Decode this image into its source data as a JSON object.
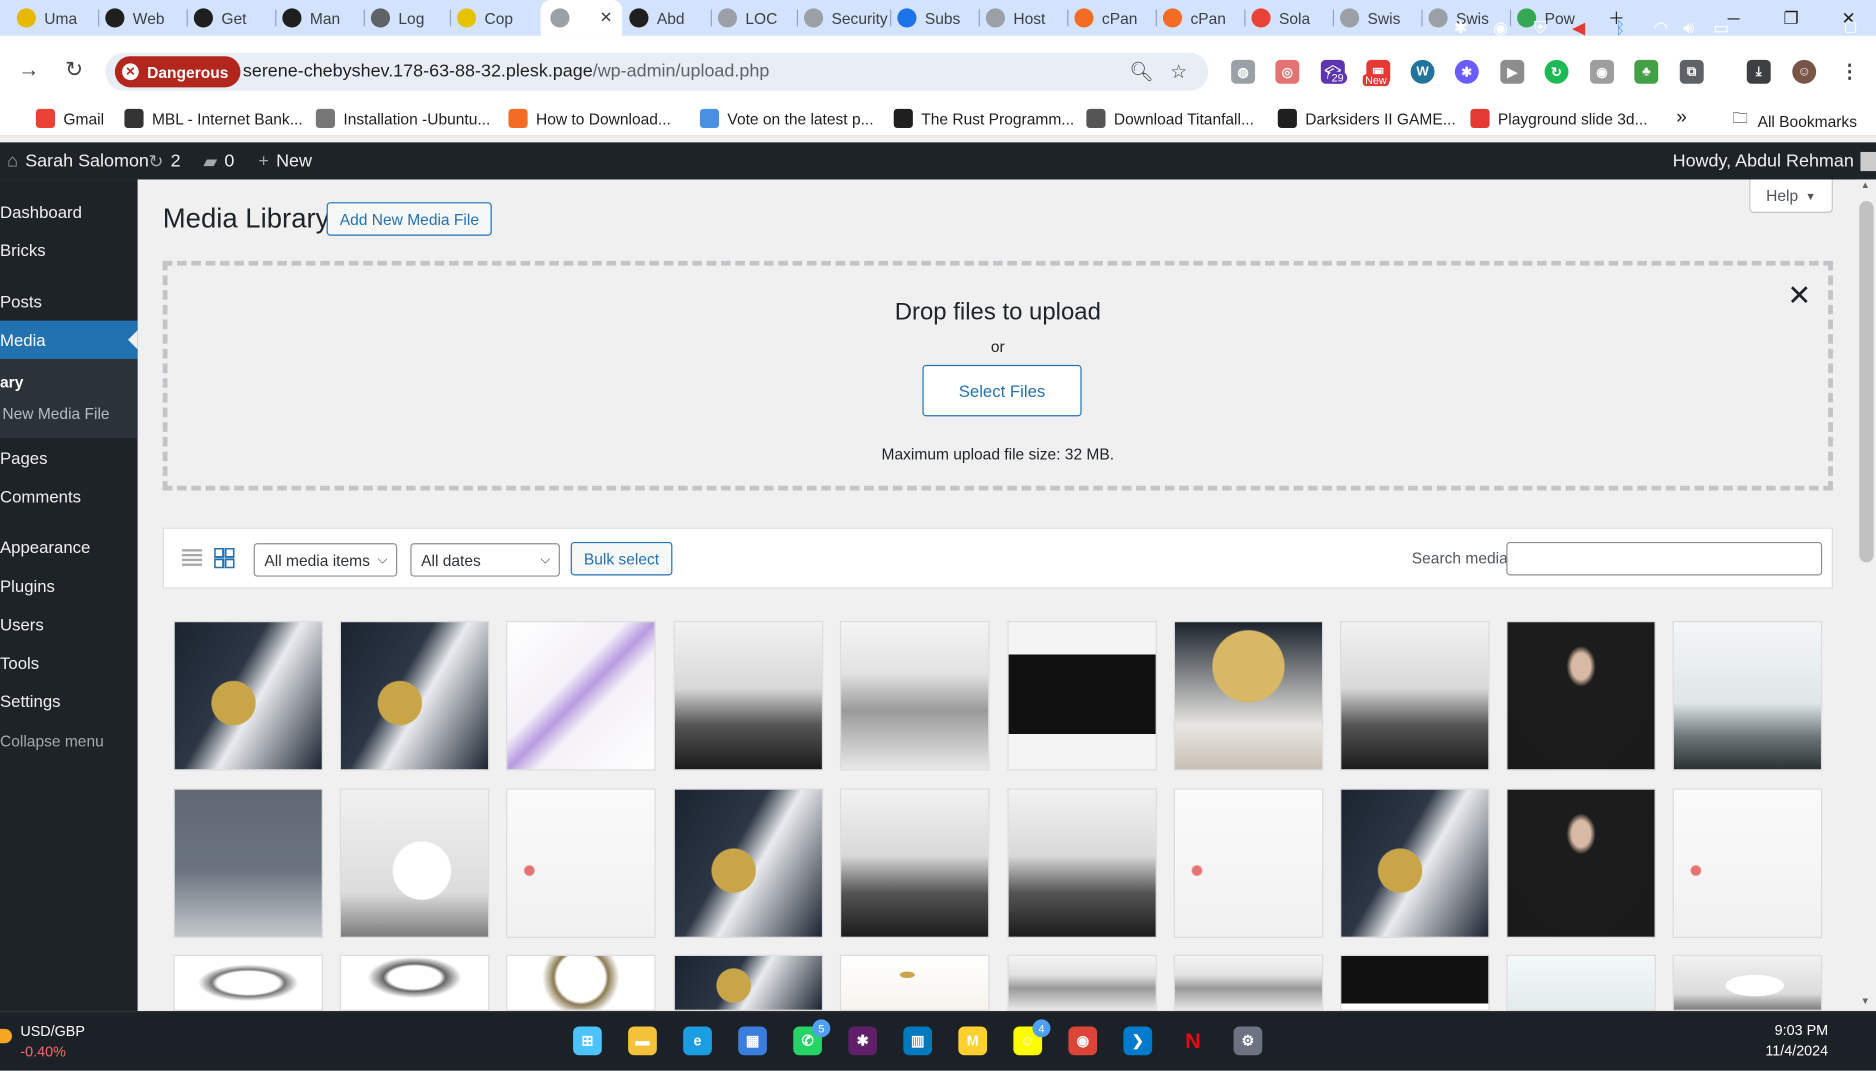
{
  "browser": {
    "tabs": [
      {
        "label": "Uma",
        "color": "#e6b800"
      },
      {
        "label": "Web",
        "color": "#1f1f1f"
      },
      {
        "label": "Get",
        "color": "#1f1f1f"
      },
      {
        "label": "Man",
        "color": "#1f1f1f"
      },
      {
        "label": "Log",
        "color": "#5f6368"
      },
      {
        "label": "Cop",
        "color": "#e6c300"
      },
      {
        "label": "",
        "color": "#9aa0a6"
      },
      {
        "label": "Abd",
        "color": "#1f1f1f"
      },
      {
        "label": "LOC",
        "color": "#9aa0a6"
      },
      {
        "label": "Security",
        "color": "#9aa0a6"
      },
      {
        "label": "Subs",
        "color": "#1a73e8"
      },
      {
        "label": "Host",
        "color": "#9aa0a6"
      },
      {
        "label": "cPan",
        "color": "#f36c23"
      },
      {
        "label": "cPan",
        "color": "#f36c23"
      },
      {
        "label": "Sola",
        "color": "#ea4335"
      },
      {
        "label": "Swis",
        "color": "#9aa0a6"
      },
      {
        "label": "Swis",
        "color": "#9aa0a6"
      },
      {
        "label": "Pow",
        "color": "#34a853"
      }
    ],
    "security_label": "Dangerous",
    "url_host": "serene-chebyshev.178-63-88-32.plesk.page",
    "url_path": "/wp-admin/upload.php",
    "extension_badges": {
      "notifications": "29",
      "new": "New"
    },
    "bookmarks": [
      {
        "label": "Gmail",
        "color": "#ea4335"
      },
      {
        "label": "MBL - Internet Bank...",
        "color": "#333333"
      },
      {
        "label": "Installation -Ubuntu...",
        "color": "#777777"
      },
      {
        "label": "How to Download...",
        "color": "#f36c23"
      },
      {
        "label": "Vote on the latest p...",
        "color": "#4a90e2"
      },
      {
        "label": "The Rust Programm...",
        "color": "#1f1f1f"
      },
      {
        "label": "Download Titanfall...",
        "color": "#555555"
      },
      {
        "label": "Darksiders II GAME...",
        "color": "#1f1f1f"
      },
      {
        "label": "Playground slide 3d...",
        "color": "#e53935"
      }
    ],
    "all_bookmarks": "All Bookmarks"
  },
  "adminbar": {
    "site_name": "Sarah Salomon",
    "updates": "2",
    "comments": "0",
    "new_label": "New",
    "howdy": "Howdy, Abdul Rehman"
  },
  "sidebar": {
    "items": [
      {
        "label": "Dashboard"
      },
      {
        "label": "Bricks"
      },
      {
        "label": "Posts"
      },
      {
        "label": "Media"
      },
      {
        "label": "Pages"
      },
      {
        "label": "Comments"
      },
      {
        "label": "Appearance"
      },
      {
        "label": "Plugins"
      },
      {
        "label": "Users"
      },
      {
        "label": "Tools"
      },
      {
        "label": "Settings"
      },
      {
        "label": "Collapse menu"
      }
    ],
    "submenu": [
      "ary",
      "New Media File"
    ]
  },
  "main": {
    "title": "Media Library",
    "add_new": "Add New Media File",
    "help": "Help",
    "upload": {
      "drop_title": "Drop files to upload",
      "or": "or",
      "select_files": "Select Files",
      "max_size": "Maximum upload file size: 32 MB."
    },
    "filters": {
      "type": "All media items",
      "dates": "All dates",
      "bulk_select": "Bulk select",
      "search_label": "Search media",
      "search_value": ""
    },
    "media_grid": [
      [
        "moon",
        "moon",
        "product-box",
        "wolf-fog",
        "mountain-fog",
        "black-band",
        "moon-woman",
        "wolf-fog",
        "woman-dark",
        "misty-sea"
      ],
      [
        "gray-gradient",
        "swan",
        "white-brush",
        "moon",
        "wolf-fog",
        "wolf-fog",
        "white-brush",
        "moon",
        "woman-dark",
        "white-brush"
      ],
      [
        "jewel-heart",
        "jewel-diamond",
        "jewel-ring",
        "moon",
        "gold-script",
        "mountain-fog",
        "mountain-fog",
        "black-square",
        "pale-mist",
        "swan"
      ]
    ]
  },
  "taskbar": {
    "ticker_name": "USD/GBP",
    "ticker_change": "-0.40%",
    "time": "9:03 PM",
    "date": "11/4/2024",
    "whatsapp_badge": "5",
    "snap_badge": "4"
  }
}
